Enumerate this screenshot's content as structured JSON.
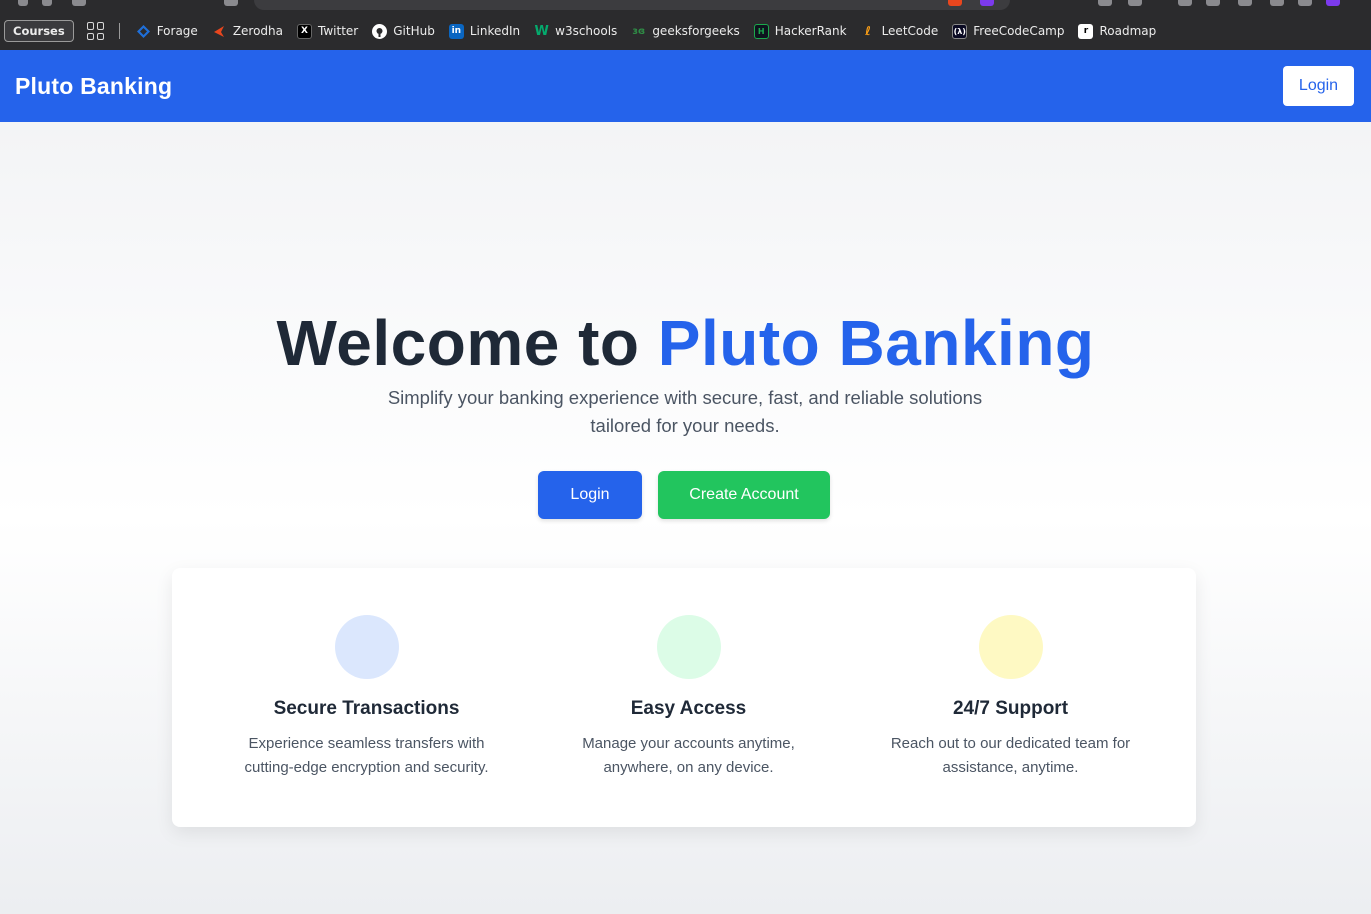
{
  "bookmarks": {
    "courses_label": "Courses",
    "items": [
      {
        "label": "Forage",
        "icon": "forage-icon",
        "color": "#1e6fd9"
      },
      {
        "label": "Zerodha",
        "icon": "zerodha-icon",
        "color": "#e8461e"
      },
      {
        "label": "Twitter",
        "icon": "x-twitter-icon",
        "color": "#000000"
      },
      {
        "label": "GitHub",
        "icon": "github-icon",
        "color": "#ffffff"
      },
      {
        "label": "LinkedIn",
        "icon": "linkedin-icon",
        "color": "#0a66c2"
      },
      {
        "label": "w3schools",
        "icon": "w3schools-icon",
        "color": "#04aa6d"
      },
      {
        "label": "geeksforgeeks",
        "icon": "geeksforgeeks-icon",
        "color": "#2f8d46"
      },
      {
        "label": "HackerRank",
        "icon": "hackerrank-icon",
        "color": "#1ba94c"
      },
      {
        "label": "LeetCode",
        "icon": "leetcode-icon",
        "color": "#ffa116"
      },
      {
        "label": "FreeCodeCamp",
        "icon": "freecodecamp-icon",
        "color": "#0a0a23"
      },
      {
        "label": "Roadmap",
        "icon": "roadmap-icon",
        "color": "#000000"
      }
    ]
  },
  "navbar": {
    "brand": "Pluto Banking",
    "login_label": "Login",
    "color": "#2563eb"
  },
  "hero": {
    "title_prefix": "Welcome to ",
    "title_accent": "Pluto Banking",
    "subtitle": "Simplify your banking experience with secure, fast, and reliable solutions tailored for your needs.",
    "login_label": "Login",
    "create_label": "Create Account"
  },
  "features": [
    {
      "title": "Secure Transactions",
      "description": "Experience seamless transfers with cutting-edge encryption and security.",
      "color": "#dbe7fd"
    },
    {
      "title": "Easy Access",
      "description": "Manage your accounts anytime, anywhere, on any device.",
      "color": "#dcfce7"
    },
    {
      "title": "24/7 Support",
      "description": "Reach out to our dedicated team for assistance, anytime.",
      "color": "#fef9c3"
    }
  ]
}
